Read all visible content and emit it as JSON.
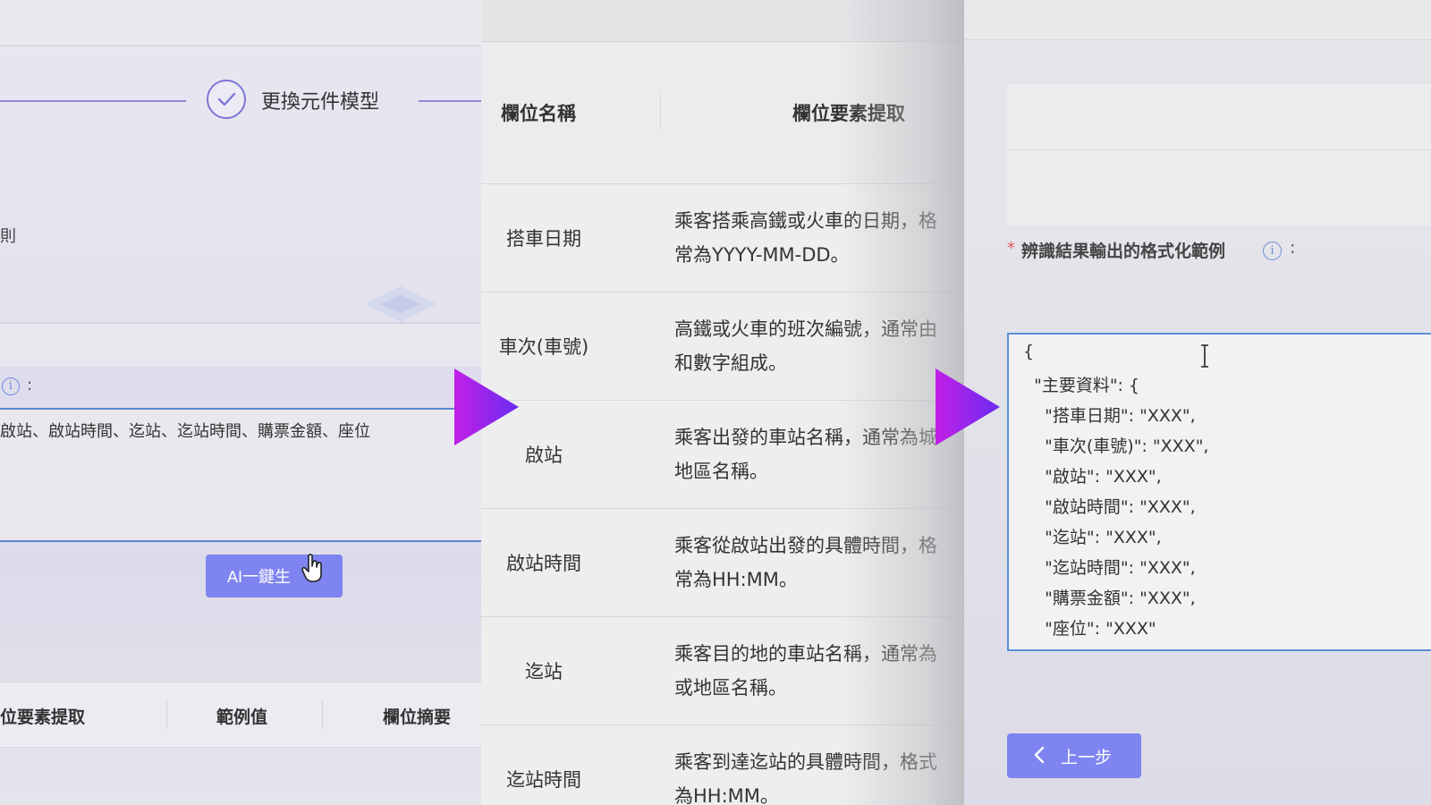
{
  "panel1": {
    "step_label": "更換元件模型",
    "rule_fragment": "則",
    "info_colon": ":",
    "textarea_value": "啟站、啟站時間、迄站、迄站時間、購票金額、座位",
    "ai_button_label": "AI一鍵生",
    "table_headers": [
      "位要素提取",
      "範例值",
      "欄位摘要"
    ]
  },
  "panel2": {
    "headers": {
      "field_name": "欄位名稱",
      "element_extraction": "欄位要素提取"
    },
    "rows": [
      {
        "name": "搭車日期",
        "desc": "乘客搭乘高鐵或火車的日期，格\n常為YYYY-MM-DD。"
      },
      {
        "name": "車次(車號)",
        "desc": "高鐵或火車的班次編號，通常由\n和數字組成。"
      },
      {
        "name": "啟站",
        "desc": "乘客出發的車站名稱，通常為城\n地區名稱。"
      },
      {
        "name": "啟站時間",
        "desc": "乘客從啟站出發的具體時間，格\n常為HH:MM。"
      },
      {
        "name": "迄站",
        "desc": "乘客目的地的車站名稱，通常為\n或地區名稱。"
      },
      {
        "name": "迄站時間",
        "desc": "乘客到達迄站的具體時間，格式\n為HH:MM。"
      }
    ]
  },
  "panel3": {
    "required_mark": "*",
    "output_label": "辨識結果輸出的格式化範例",
    "colon": ":",
    "json_lines": [
      "{",
      "  \"主要資料\": {",
      "    \"搭車日期\": \"XXX\",",
      "    \"車次(車號)\": \"XXX\",",
      "    \"啟站\": \"XXX\",",
      "    \"啟站時間\": \"XXX\",",
      "    \"迄站\": \"XXX\",",
      "    \"迄站時間\": \"XXX\",",
      "    \"購票金額\": \"XXX\",",
      "    \"座位\": \"XXX\""
    ],
    "prev_button_label": "上一步"
  },
  "icons": {
    "step_check": "check-circle-icon",
    "info": "info-icon",
    "pointer": "hand-pointer-icon",
    "text_cursor": "text-cursor-icon",
    "chevron": "chevron-left-icon",
    "transition_arrow": "play-arrow-icon"
  },
  "colors": {
    "accent": "#7e84f0",
    "focus_border": "#5b8fd6",
    "required": "#e05757",
    "arrow_start": "#c21fe6",
    "arrow_end": "#6a2cf0"
  }
}
